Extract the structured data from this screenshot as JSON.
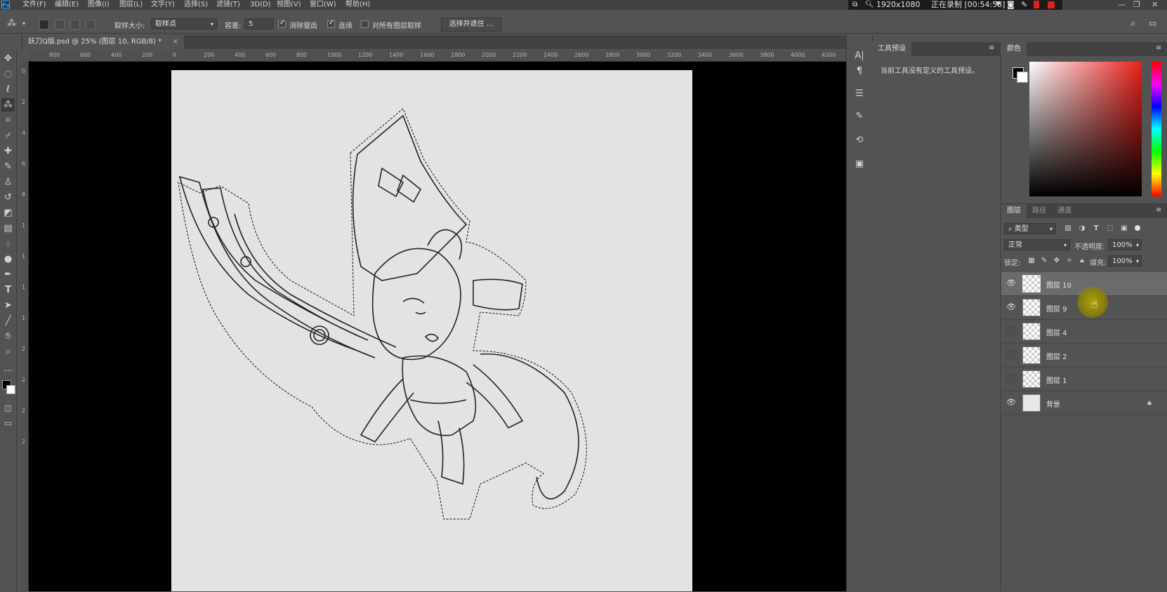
{
  "menubar": {
    "logo": "Ps",
    "items": [
      "文件(F)",
      "编辑(E)",
      "图像(I)",
      "图层(L)",
      "文字(Y)",
      "选择(S)",
      "滤镜(T)",
      "3D(D)",
      "视图(V)",
      "窗口(W)",
      "帮助(H)"
    ],
    "recorder": {
      "resolution": "1920x1080",
      "status": "正在录制 [00:54:58]"
    }
  },
  "options": {
    "sample_size_label": "取样大小:",
    "sample_size_value": "取样点",
    "tolerance_label": "容差:",
    "tolerance_value": "5",
    "antialias_label": "消除锯齿",
    "antialias_checked": true,
    "contiguous_label": "连续",
    "contiguous_checked": true,
    "all_layers_label": "对所有图层取样",
    "all_layers_checked": false,
    "select_mask_button": "选择并遮住 ..."
  },
  "document": {
    "tab_title": "妖刀Q版.psd @ 25% (图层 10, RGB/8) *",
    "close_glyph": "×",
    "zoom": "25%",
    "canvas_bg": "#e3e3e3"
  },
  "ruler": {
    "top_ticks": [
      "800",
      "600",
      "400",
      "200",
      "0",
      "200",
      "400",
      "600",
      "800",
      "1000",
      "1200",
      "1400",
      "1600",
      "1800",
      "2000",
      "2200",
      "2400",
      "2600",
      "2800",
      "3000",
      "3200",
      "3400",
      "3600",
      "3800",
      "4000",
      "4200"
    ],
    "left_ticks": [
      "0",
      "2",
      "4",
      "6",
      "8",
      "1",
      "1",
      "1",
      "1",
      "2",
      "2",
      "2",
      "2"
    ]
  },
  "toolbar": {
    "tools": [
      "move-icon",
      "marquee-icon",
      "lasso-icon",
      "magic-wand-icon",
      "crop-icon",
      "eyedropper-icon",
      "healing-icon",
      "brush-icon",
      "stamp-icon",
      "history-brush-icon",
      "eraser-icon",
      "gradient-icon",
      "blur-icon",
      "dodge-icon",
      "pen-icon",
      "type-icon",
      "path-select-icon",
      "line-icon",
      "hand-icon",
      "zoom-icon",
      "more-icon"
    ]
  },
  "presets_panel": {
    "tab": "工具预设",
    "message": "当前工具没有定义的工具预设。"
  },
  "color_panel": {
    "tab": "颜色",
    "foreground": "#000000",
    "background": "#ffffff"
  },
  "layers_panel": {
    "tabs": [
      "图层",
      "路径",
      "通道"
    ],
    "filter_label": "类型",
    "blend_mode": "正常",
    "opacity_label": "不透明度:",
    "opacity_value": "100%",
    "lock_label": "锁定:",
    "fill_label": "填充:",
    "fill_value": "100%",
    "layers": [
      {
        "name": "图层 10",
        "visible": true,
        "selected": true
      },
      {
        "name": "图层 9",
        "visible": true,
        "selected": false
      },
      {
        "name": "图层 4",
        "visible": false,
        "selected": false
      },
      {
        "name": "图层 2",
        "visible": false,
        "selected": false
      },
      {
        "name": "图层 1",
        "visible": false,
        "selected": false
      },
      {
        "name": "背景",
        "visible": true,
        "selected": false,
        "locked": true
      }
    ]
  },
  "cursor": {
    "color": "#bdb100"
  }
}
